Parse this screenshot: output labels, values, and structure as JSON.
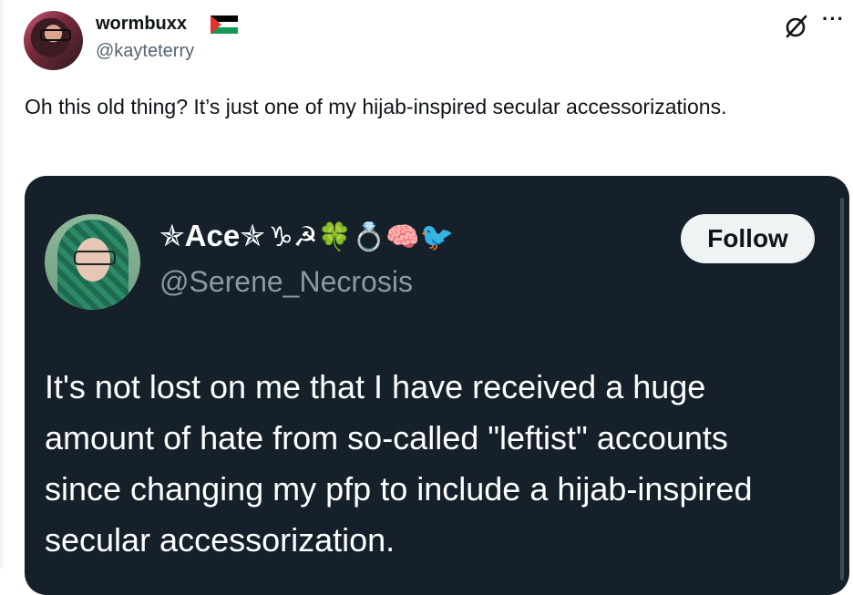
{
  "tweet": {
    "display_name": "wormbuxx",
    "handle": "@kayteterry",
    "text": "Oh this old thing? It’s just one of my hijab-inspired secular accessorizations."
  },
  "quote": {
    "display_name": "✯Ace✯",
    "name_emojis": "♑☭🍀💍🧠🐦",
    "handle": "@Serene_Necrosis",
    "follow_label": "Follow",
    "text": "It's not lost on me that I have received a huge amount of hate from so-called \"leftist\" accounts since changing my pfp to include a hijab-inspired secular accessorization."
  },
  "icons": {
    "author_flag": "palestine-flag-icon",
    "tool": "grok-icon",
    "more": "more-icon"
  },
  "colors": {
    "quote_bg": "#15202b",
    "handle_gray": "#536471",
    "quote_handle_gray": "#8b98a5"
  }
}
